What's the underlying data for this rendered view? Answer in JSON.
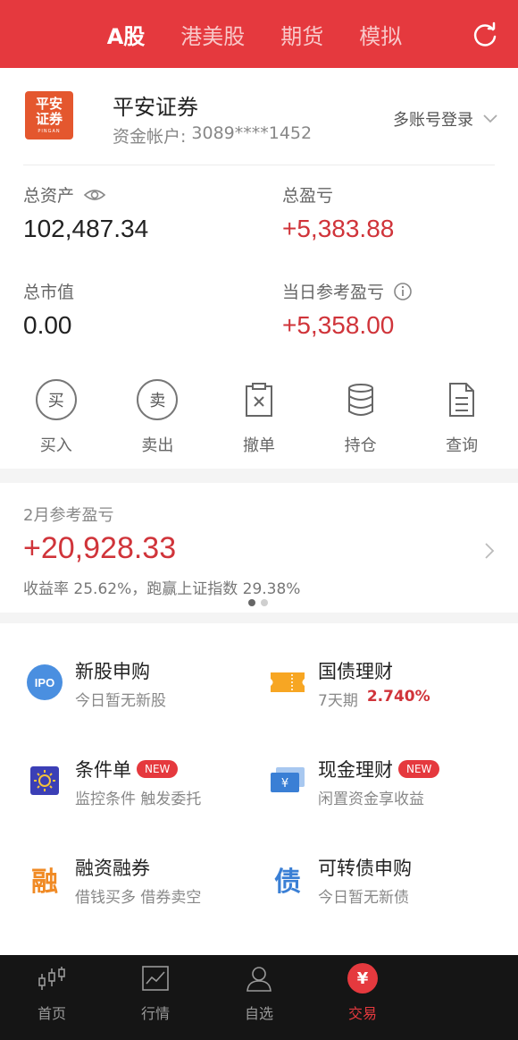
{
  "top_tabs": [
    "A股",
    "港美股",
    "期货",
    "模拟"
  ],
  "account": {
    "broker_name": "平安证券",
    "logo_line1": "平安",
    "logo_line2": "证券",
    "logo_sub": "PINGAN",
    "account_label": "资金帐户:",
    "account_number": "3089****1452",
    "multi_login": "多账号登录"
  },
  "metrics": {
    "total_assets_label": "总资产",
    "total_assets": "102,487.34",
    "total_pl_label": "总盈亏",
    "total_pl": "+5,383.88",
    "market_value_label": "总市值",
    "market_value": "0.00",
    "daily_pl_label": "当日参考盈亏",
    "daily_pl": "+5,358.00"
  },
  "actions": [
    {
      "label": "买入",
      "glyph": "买"
    },
    {
      "label": "卖出",
      "glyph": "卖"
    },
    {
      "label": "撤单"
    },
    {
      "label": "持仓"
    },
    {
      "label": "查询"
    }
  ],
  "monthly": {
    "label": "2月参考盈亏",
    "value": "+20,928.33",
    "summary": "收益率 25.62%，跑赢上证指数 29.38%",
    "page_dots": 2,
    "active_dot": 0
  },
  "services": [
    {
      "name": "新股申购",
      "desc": "今日暂无新股",
      "icon": "ipo-icon",
      "icon_text": "IPO"
    },
    {
      "name": "国债理财",
      "desc": "7天期",
      "rate": "2.740%",
      "icon": "ticket-icon"
    },
    {
      "name": "条件单",
      "desc": "监控条件 触发委托",
      "badge": "NEW",
      "icon": "condition-order-icon"
    },
    {
      "name": "现金理财",
      "desc": "闲置资金享收益",
      "badge": "NEW",
      "icon": "cash-icon",
      "icon_text": "¥"
    },
    {
      "name": "融资融券",
      "desc": "借钱买多 借券卖空",
      "icon": "margin-icon",
      "icon_text": "融"
    },
    {
      "name": "可转债申购",
      "desc": "今日暂无新债",
      "icon": "bond-icon",
      "icon_text": "债"
    }
  ],
  "bottom_nav": [
    {
      "label": "首页",
      "icon": "home-candlestick-icon"
    },
    {
      "label": "行情",
      "icon": "market-chart-icon"
    },
    {
      "label": "自选",
      "icon": "watchlist-user-icon"
    },
    {
      "label": "交易",
      "icon": "trade-yen-icon",
      "glyph": "¥",
      "active": true
    }
  ],
  "colors": {
    "brand_red": "#e5393e",
    "profit_red": "#d0343a",
    "nav_bg": "#151515"
  }
}
